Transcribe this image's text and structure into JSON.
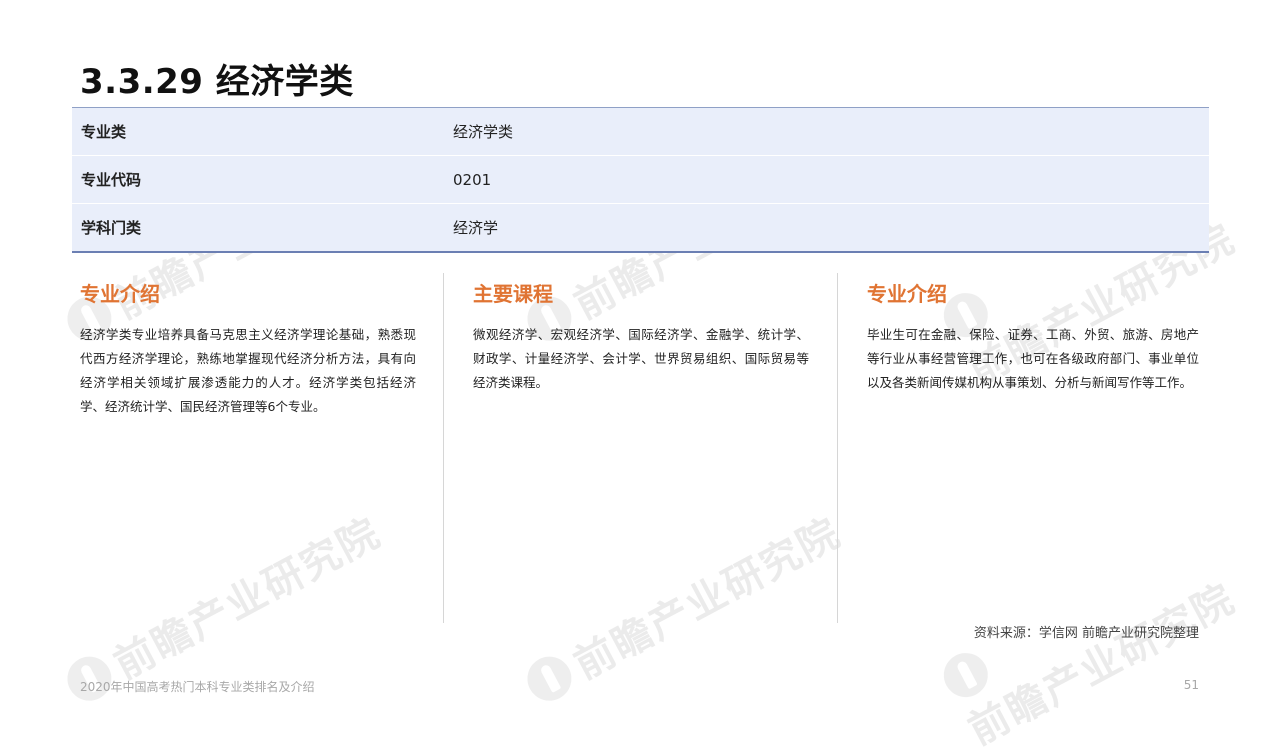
{
  "title": "3.3.29 经济学类",
  "info_table": [
    {
      "key": "专业类",
      "value": "经济学类"
    },
    {
      "key": "专业代码",
      "value": "0201"
    },
    {
      "key": "学科门类",
      "value": "经济学"
    }
  ],
  "columns": [
    {
      "heading": "专业介绍",
      "body": "经济学类专业培养具备马克思主义经济学理论基础，熟悉现代西方经济学理论，熟练地掌握现代经济分析方法，具有向经济学相关领域扩展渗透能力的人才。经济学类包括经济学、经济统计学、国民经济管理等6个专业。"
    },
    {
      "heading": "主要课程",
      "body": "微观经济学、宏观经济学、国际经济学、金融学、统计学、财政学、计量经济学、会计学、世界贸易组织、国际贸易等经济类课程。"
    },
    {
      "heading": "专业介绍",
      "body": "毕业生可在金融、保险、证券、工商、外贸、旅游、房地产等行业从事经营管理工作，也可在各级政府部门、事业单位以及各类新闻传媒机构从事策划、分析与新闻写作等工作。"
    }
  ],
  "source": "资料来源：学信网 前瞻产业研究院整理",
  "footer": {
    "left": "2020年中国高考热门本科专业类排名及介绍",
    "page_number": "51"
  },
  "watermark": {
    "text": "前瞻产业研究院",
    "icon": "qianzhan-logo-icon"
  },
  "colors": {
    "accent": "#e07433",
    "table_bg": "#e9eefa",
    "table_border": "#6b7fb3"
  }
}
